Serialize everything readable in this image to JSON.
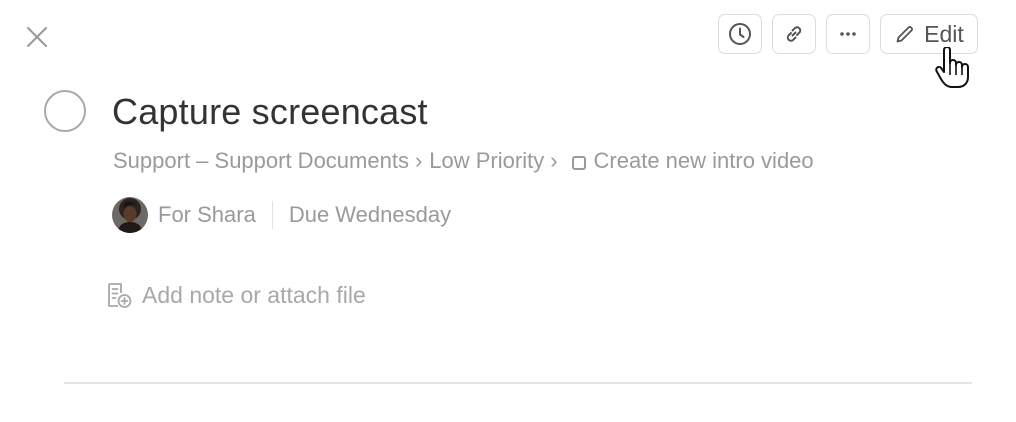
{
  "toolbar": {
    "edit_label": "Edit",
    "icons": [
      "history-icon",
      "link-icon",
      "more-icon",
      "pencil-icon"
    ]
  },
  "task": {
    "title": "Capture screencast",
    "breadcrumb": {
      "project": "Support – Support Documents",
      "section": "Low Priority",
      "parent_task": "Create new intro video",
      "separator": "›"
    },
    "assignee": "For Shara",
    "due": "Due Wednesday",
    "note_placeholder": "Add note or attach file"
  },
  "colors": {
    "text_primary": "#333333",
    "text_muted": "#9a9a9a",
    "border": "#dcdcdc"
  }
}
